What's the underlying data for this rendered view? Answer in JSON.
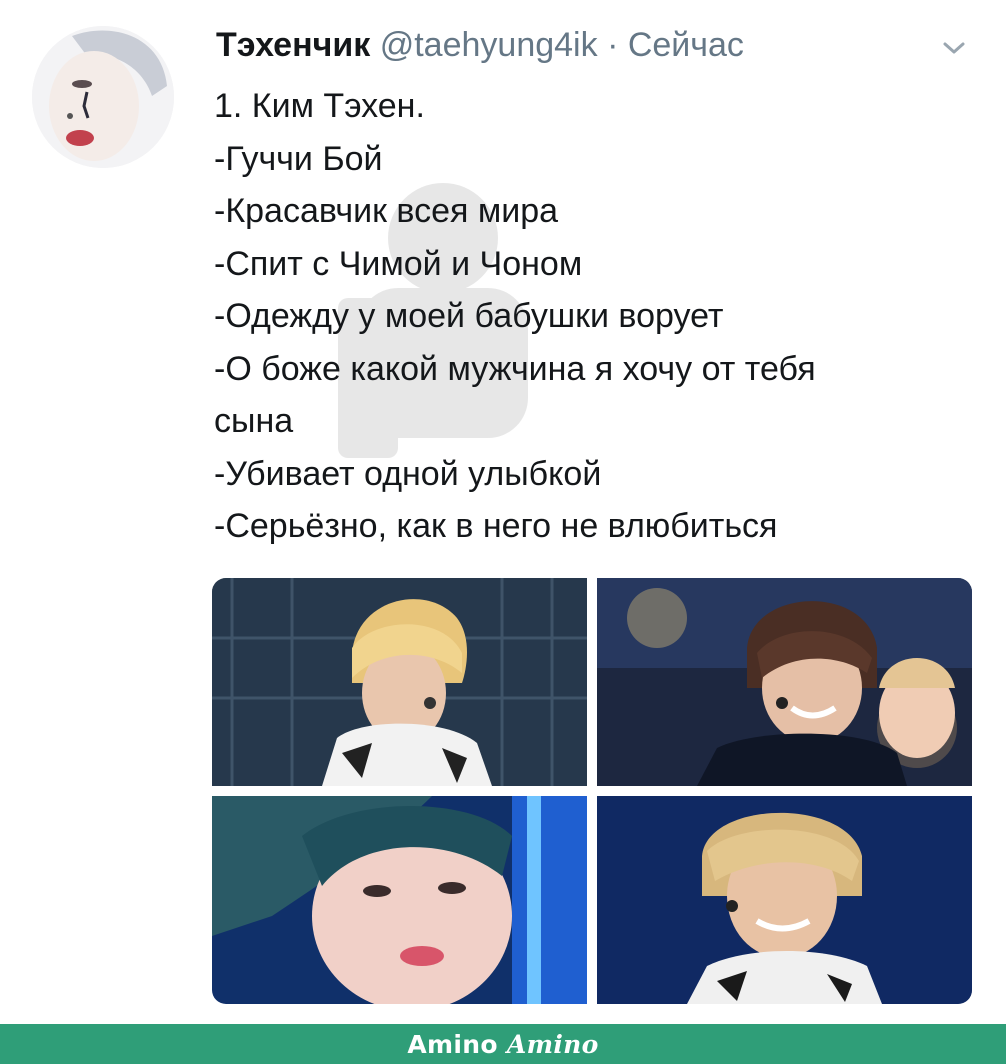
{
  "tweet": {
    "display_name": "Тэхенчик",
    "handle": "@taehyung4ik",
    "separator": "·",
    "timestamp": "Сейчас",
    "menu_icon": "chevron-down-icon",
    "lines": [
      "1. Ким Тэхен.",
      "-Гуччи Бой",
      "-Красавчик всея мира",
      "-Спит с Чимой и Чоном",
      "-Одежду у моей бабушки ворует",
      "-О боже какой мужчина я хочу от тебя",
      "сына",
      "-Убивает одной улыбкой",
      "-Серьёзно, как в него не влюбиться"
    ]
  },
  "footer": {
    "brand": "Amino",
    "brand_script": "Amino"
  },
  "colors": {
    "text": "#14171a",
    "secondary_text": "#657786",
    "footer_bg": "#2f9e78"
  }
}
